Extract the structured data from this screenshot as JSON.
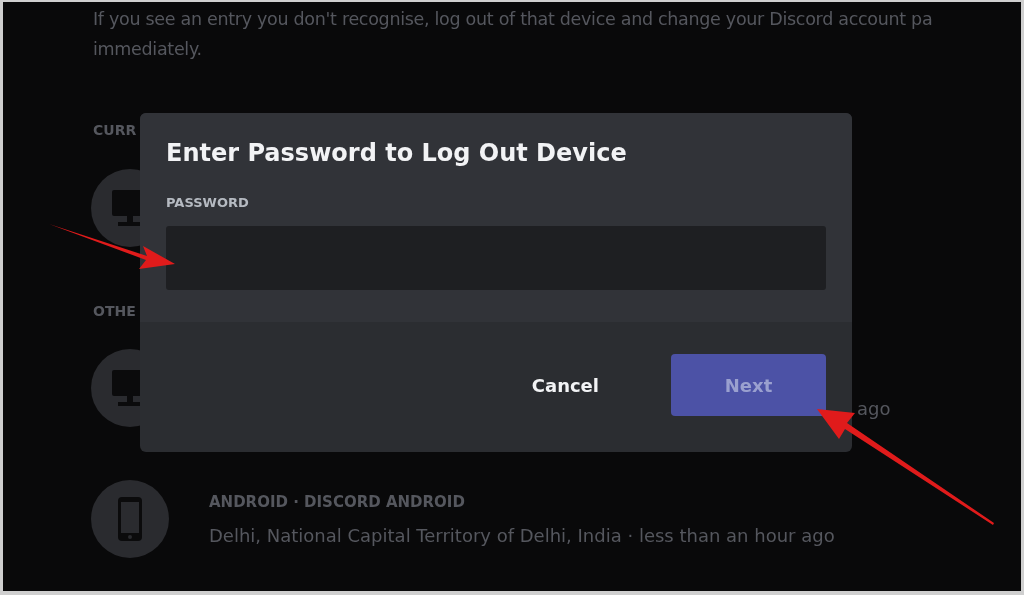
{
  "background": {
    "notice_lines": [
      "If you see an entry you don't recognise, log out of that device and change your Discord account pa",
      "immediately."
    ],
    "current_heading": "CURR",
    "current_devices": [
      {
        "kind": "desktop"
      }
    ],
    "other_heading": "OTHE",
    "other_devices": [
      {
        "kind": "desktop",
        "detail": "ago"
      },
      {
        "kind": "phone",
        "title": "ANDROID · DISCORD ANDROID",
        "detail": "Delhi, National Capital Territory of Delhi, India · less than an hour ago"
      }
    ]
  },
  "modal": {
    "title": "Enter Password to Log Out Device",
    "field_label": "PASSWORD",
    "buttons": [
      {
        "label": "Cancel",
        "kind": "link",
        "disabled": false
      },
      {
        "label": "Next",
        "kind": "primary",
        "disabled": true
      }
    ]
  }
}
